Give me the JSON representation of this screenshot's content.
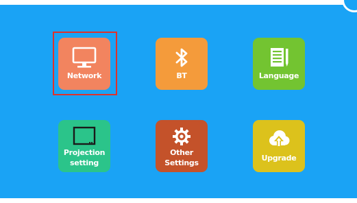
{
  "colors": {
    "background": "#1aa3f5",
    "selection_border": "#e0312a",
    "network_tile": "#f2845f",
    "bt_tile": "#f49b3b",
    "language_tile": "#73c431",
    "projection_tile": "#2bc48a",
    "other_tile": "#c4522a",
    "upgrade_tile": "#dcc21c"
  },
  "menu": {
    "selected": "Network",
    "tiles": [
      {
        "label": "Network",
        "icon": "monitor-icon"
      },
      {
        "label": "BT",
        "icon": "bluetooth-icon"
      },
      {
        "label": "Language",
        "icon": "document-pencil-icon"
      },
      {
        "label_line1": "Projection",
        "label_line2": "setting",
        "icon": "projection-screen-icon"
      },
      {
        "label_line1": "Other",
        "label_line2": "Settings",
        "icon": "gear-icon"
      },
      {
        "label": "Upgrade",
        "icon": "cloud-upload-icon"
      }
    ]
  }
}
